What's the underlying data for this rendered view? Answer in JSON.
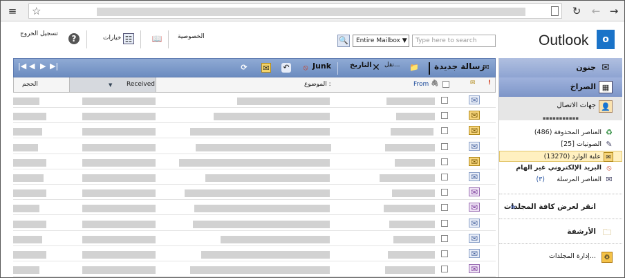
{
  "browser": {
    "menu_icon": "≡",
    "star_icon": "☆",
    "reload_icon": "↻",
    "back_icon": "←",
    "forward_icon": "→"
  },
  "header": {
    "logo_text": "Outlook",
    "logo_letter": "o",
    "search_placeholder": "Type here to search",
    "search_scope": "Entire Mailbox ▼",
    "privacy": "الخصوصية",
    "options": "خيارات",
    "signout": "تسجيل الخروج"
  },
  "toolbar": {
    "new_message": "رسالة جديدة",
    "move": "نقل...",
    "delete_label": "التاريخ",
    "junk": "Junk",
    "nav_first": "|◀",
    "nav_prev": "◀",
    "nav_next": "▶",
    "nav_last": "▶|"
  },
  "columns": {
    "from": "From",
    "subject": "الموضوع :",
    "received": "Received",
    "sort_indicator": "▼",
    "size": "الحجم"
  },
  "messages": [
    {
      "icon": "read"
    },
    {
      "icon": "unread"
    },
    {
      "icon": "unread"
    },
    {
      "icon": "read"
    },
    {
      "icon": "unread"
    },
    {
      "icon": "read"
    },
    {
      "icon": "meeting"
    },
    {
      "icon": "meeting"
    },
    {
      "icon": "read"
    },
    {
      "icon": "read"
    },
    {
      "icon": "read"
    },
    {
      "icon": "meeting"
    }
  ],
  "nav": {
    "mail": "جنون",
    "calendar": "الصراخ",
    "contacts": "جهات الاتصال",
    "folders": [
      {
        "label": "العناصر المحذوفة (486)",
        "icon": "deleted",
        "selected": false,
        "bold": false
      },
      {
        "label": "الصوتيات [25]",
        "icon": "drafts",
        "selected": false,
        "bold": false
      },
      {
        "label": "علبة الوارد (13270)",
        "icon": "inbox",
        "selected": true,
        "bold": false
      },
      {
        "label": "البريد الإلكتروني غير الهام",
        "icon": "junk",
        "selected": false,
        "bold": true
      },
      {
        "label": "العناصر المرسلة",
        "icon": "sent",
        "selected": false,
        "bold": false
      }
    ],
    "sent_count": "(٣)",
    "show_all": "انقر لعرض كافة المجلدات",
    "archive": "الأرشفة",
    "manage_folders": "إدارة المجلدات..."
  }
}
